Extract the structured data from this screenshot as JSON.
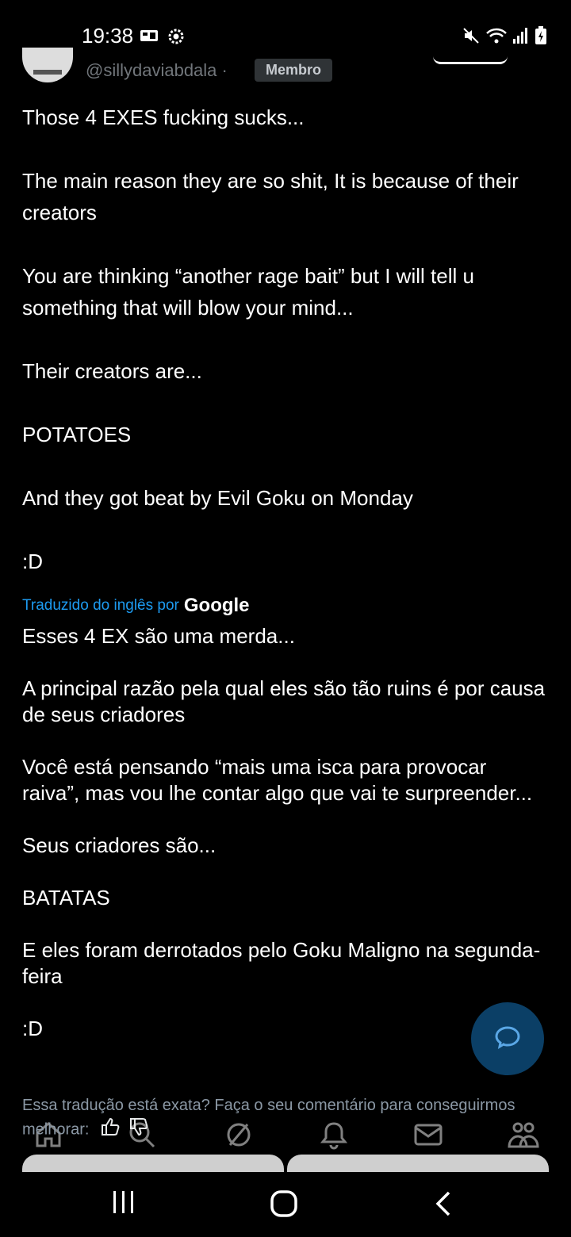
{
  "status_bar": {
    "time": "19:38",
    "left_icons": [
      "network-badge-icon",
      "settings-icon"
    ],
    "right_icons": [
      "mute-icon",
      "wifi-icon",
      "signal-icon",
      "battery-charging-icon"
    ]
  },
  "post": {
    "handle": "@sillydaviabdala",
    "separator": "·",
    "badge": "Membro",
    "original_lines": [
      "Those 4 EXES fucking sucks...",
      "",
      "The main reason they are so shit, It is because of their creators",
      "",
      "You are thinking “another rage bait” but I will tell u something that will blow your mind...",
      "",
      "Their creators are...",
      "",
      "POTATOES",
      "",
      "And they got beat by Evil Goku on Monday",
      "",
      ":D"
    ],
    "translated_by_label": "Traduzido do inglês por",
    "translated_by_brand": "Google",
    "translated_lines": [
      "Esses 4 EX são uma merda...",
      "",
      "A principal razão pela qual eles são tão ruins é por causa de seus criadores",
      "",
      "Você está pensando “mais uma isca para provocar raiva”, mas vou lhe contar algo que vai te surpreender...",
      "",
      "Seus criadores são...",
      "",
      "BATATAS",
      "",
      "E eles foram derrotados pelo Goku Maligno na segunda-feira",
      "",
      ":D"
    ],
    "feedback_text": "Essa tradução está exata? Faça o seu comentário para conseguirmos melhorar:"
  },
  "bottom_nav": {
    "items": [
      "home-icon",
      "search-icon",
      "grok-icon",
      "notifications-icon",
      "messages-icon",
      "communities-icon"
    ]
  },
  "colors": {
    "background": "#000000",
    "accent": "#1d9bf0",
    "fab": "#0b3f66"
  }
}
